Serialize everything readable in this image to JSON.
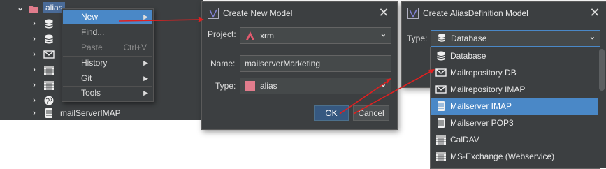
{
  "tree": {
    "root_label": "alias",
    "visible_label": "mailServerIMAP",
    "row_icons": [
      "database-icon",
      "database-icon",
      "envelope-icon",
      "calendar-icon",
      "calendar-icon",
      "server-icon",
      "globe-icon",
      "server-icon"
    ]
  },
  "context_menu": {
    "items": [
      {
        "label": "New",
        "shortcut": "",
        "submenu": true,
        "state": "selected"
      },
      {
        "label": "Find...",
        "shortcut": "",
        "submenu": false,
        "state": "normal"
      },
      {
        "label": "Paste",
        "shortcut": "Ctrl+V",
        "submenu": false,
        "state": "disabled"
      },
      {
        "label": "History",
        "shortcut": "",
        "submenu": true,
        "state": "normal"
      },
      {
        "label": "Git",
        "shortcut": "",
        "submenu": true,
        "state": "normal"
      },
      {
        "label": "Tools",
        "shortcut": "",
        "submenu": true,
        "state": "normal"
      }
    ]
  },
  "create_model_dialog": {
    "title": "Create New Model",
    "project_label": "Project:",
    "project_value": "xrm",
    "name_label": "Name:",
    "name_value": "mailserverMarketing",
    "type_label": "Type:",
    "type_value": "alias",
    "ok_label": "OK",
    "cancel_label": "Cancel"
  },
  "alias_dialog": {
    "title": "Create AliasDefinition Model",
    "type_label": "Type:",
    "type_value": "Database",
    "options": [
      {
        "label": "Database",
        "icon": "database-icon",
        "selected": false
      },
      {
        "label": "Mailrepository DB",
        "icon": "envelope-icon",
        "selected": false
      },
      {
        "label": "Mailrepository IMAP",
        "icon": "envelope-icon",
        "selected": false
      },
      {
        "label": "Mailserver IMAP",
        "icon": "server-icon",
        "selected": true
      },
      {
        "label": "Mailserver POP3",
        "icon": "server-icon",
        "selected": false
      },
      {
        "label": "CalDAV",
        "icon": "calendar-icon",
        "selected": false
      },
      {
        "label": "MS-Exchange (Webservice)",
        "icon": "calendar-icon",
        "selected": false
      }
    ]
  },
  "colors": {
    "panel_bg": "#3c3f41",
    "selection": "#4a88c7",
    "arrow": "#e02020",
    "folder": "#e07c8c",
    "alias_swatch": "#e07c8c"
  }
}
